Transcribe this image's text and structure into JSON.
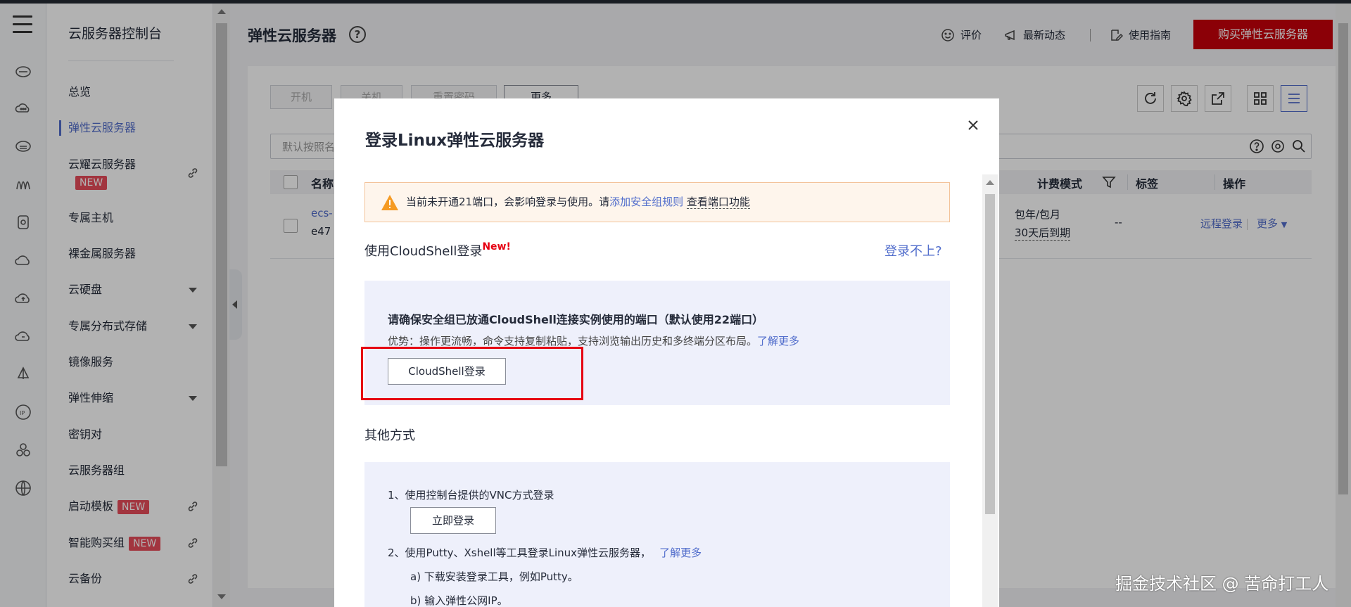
{
  "sidebar": {
    "title": "云服务器控制台",
    "items": [
      {
        "label": "总览"
      },
      {
        "label": "弹性云服务器"
      },
      {
        "label": "云耀云服务器",
        "badge": "NEW"
      },
      {
        "label": "专属主机"
      },
      {
        "label": "裸金属服务器"
      },
      {
        "label": "云硬盘"
      },
      {
        "label": "专属分布式存储"
      },
      {
        "label": "镜像服务"
      },
      {
        "label": "弹性伸缩"
      },
      {
        "label": "密钥对"
      },
      {
        "label": "云服务器组"
      },
      {
        "label": "启动模板",
        "badge": "NEW"
      },
      {
        "label": "智能购买组",
        "badge": "NEW"
      },
      {
        "label": "云备份"
      }
    ]
  },
  "header": {
    "title": "弹性云服务器",
    "help": "?",
    "rate": "评价",
    "news": "最新动态",
    "guide": "使用指南",
    "buy": "购买弹性云服务器"
  },
  "toolbar": {
    "power_on": "开机",
    "power_off": "关机",
    "reset_password": "重置密码",
    "more": "更多"
  },
  "search": {
    "placeholder": "默认按照名称搜索"
  },
  "table": {
    "col_name": "名称",
    "col_billing": "计费模式",
    "col_tags": "标签",
    "col_ops": "操作",
    "row": {
      "name": "ecs-",
      "id": "e47",
      "billing_1": "包年/包月",
      "billing_2": "30天后到期",
      "tags": "--",
      "remote_login": "远程登录",
      "more": "更多"
    }
  },
  "modal": {
    "title": "登录Linux弹性云服务器",
    "warning": "当前未开通21端口，会影响登录与使用。请",
    "warning_link1": "添加安全组规则",
    "warning_link2": "查看端口功能",
    "cloudshell_title": "使用CloudShell登录",
    "cloudshell_new": "New!",
    "cant_login": "登录不上?",
    "box1_title": "请确保安全组已放通CloudShell连接实例使用的端口（默认使用22端口）",
    "box1_desc": "优势：操作更流畅，命令支持复制粘贴，支持浏览输出历史和多终端分区布局。",
    "box1_link": "了解更多",
    "cloudshell_button": "CloudShell登录",
    "other_title": "其他方式",
    "vnc_line": "1、使用控制台提供的VNC方式登录",
    "vnc_button": "立即登录",
    "putty_line": "2、使用Putty、Xshell等工具登录Linux弹性云服务器，",
    "putty_link": "了解更多",
    "step_a": "a) 下载安装登录工具，例如Putty。",
    "step_b": "b) 输入弹性公网IP。"
  },
  "watermark": "掘金技术社区 @ 苦命打工人",
  "colors": {
    "brand_red": "#c7000b",
    "link_blue": "#526ecc",
    "badge_red": "#e84c5b",
    "highlight_red": "#e60012"
  }
}
